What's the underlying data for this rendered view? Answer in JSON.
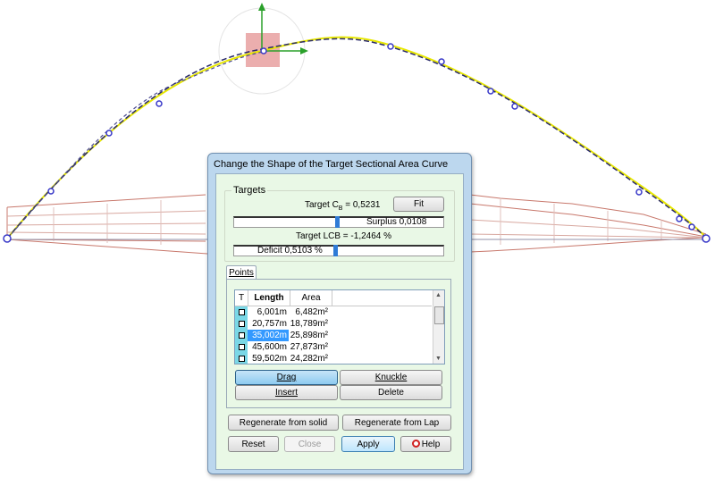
{
  "dialog": {
    "title": "Change the Shape of the Target Sectional Area Curve",
    "targets": {
      "group_label": "Targets",
      "cb_label": "Target C",
      "cb_subscript": "B",
      "cb_value": " = 0,5231",
      "fit_button": "Fit",
      "surplus_label": "Surplus 0,0108",
      "surplus_level": 0.48,
      "lcb_label": "Target LCB = -1,2464 %",
      "deficit_label": "Deficit 0,5103 %",
      "deficit_level": 0.47
    },
    "points": {
      "tab_label": "Points",
      "columns": [
        "T",
        "Length",
        "Area"
      ],
      "rows": [
        {
          "length": "6,001m",
          "area": "6,482m²",
          "selected": false
        },
        {
          "length": "20,757m",
          "area": "18,789m²",
          "selected": false
        },
        {
          "length": "35,002m",
          "area": "25,898m²",
          "selected": true
        },
        {
          "length": "45,600m",
          "area": "27,873m²",
          "selected": false
        },
        {
          "length": "59,502m",
          "area": "24,282m²",
          "selected": false
        }
      ],
      "drag_button": "Drag",
      "knuckle_button": "Knuckle",
      "insert_button": "Insert",
      "delete_button": "Delete"
    },
    "regen_solid_button": "Regenerate from solid",
    "regen_lap_button": "Regenerate from Lap",
    "reset_button": "Reset",
    "close_button": "Close",
    "apply_button": "Apply",
    "help_button": "Help"
  },
  "colors": {
    "curve_yellow": "#e8e800",
    "curve_dark": "#2a2a6a",
    "control_point": "#3838c8",
    "hull_lines": "#c8786c",
    "gizmo_red": "#e8a0a0",
    "gizmo_green": "#2aa02a",
    "dialog_frame": "#bcd7ee",
    "dialog_client": "#e9f8e6"
  }
}
